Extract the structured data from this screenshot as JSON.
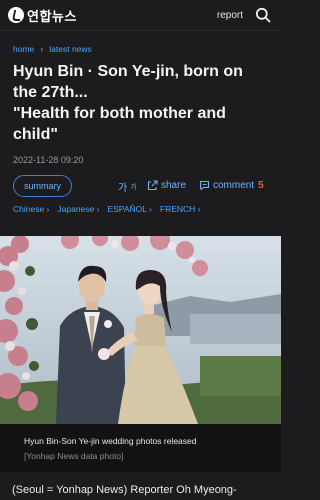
{
  "header": {
    "logo_text": "연합뉴스",
    "report_label": "report",
    "search_icon": "search-icon"
  },
  "breadcrumb": {
    "home": "home",
    "section": "latest news"
  },
  "article": {
    "headline_line1": "Hyun Bin · Son Ye-jin, born on",
    "headline_line2": "the 27th...",
    "headline_line3": "\"Health for both mother and",
    "headline_line4": "child\"",
    "datetime": "2022-11-28 09:20"
  },
  "actions": {
    "summary_label": "summary",
    "font_label": "가",
    "share_label": "share",
    "comment_label": "comment",
    "comment_count": "5"
  },
  "languages": [
    "Chinese",
    "Japanese",
    "ESPAÑOL",
    "FRENCH"
  ],
  "photo": {
    "caption": "Hyun Bin-Son Ye-jin wedding photos released",
    "credit": "[Yonhap News data photo]"
  },
  "body": {
    "first_line": "(Seoul = Yonhap News) Reporter Oh Myeong-"
  },
  "colors": {
    "background": "#1c1c1e",
    "link_blue": "#4aa3ff",
    "comment_count_red": "#ff4f3d"
  }
}
